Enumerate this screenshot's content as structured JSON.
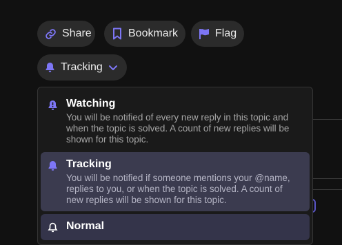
{
  "toolbar": {
    "share_label": "Share",
    "bookmark_label": "Bookmark",
    "flag_label": "Flag"
  },
  "notifications": {
    "current_label": "Tracking",
    "accent_color": "#6c63ff",
    "options": [
      {
        "title": "Watching",
        "description": "You will be notified of every new reply in this topic and when the topic is solved. A count of new replies will be shown for this topic.",
        "icon": "bell-exclamation-icon"
      },
      {
        "title": "Tracking",
        "description": "You will be notified if someone mentions your @name, replies to you, or when the topic is solved. A count of new replies will be shown for this topic.",
        "icon": "bell-icon"
      },
      {
        "title": "Normal",
        "description": "",
        "icon": "bell-outline-icon"
      }
    ]
  }
}
